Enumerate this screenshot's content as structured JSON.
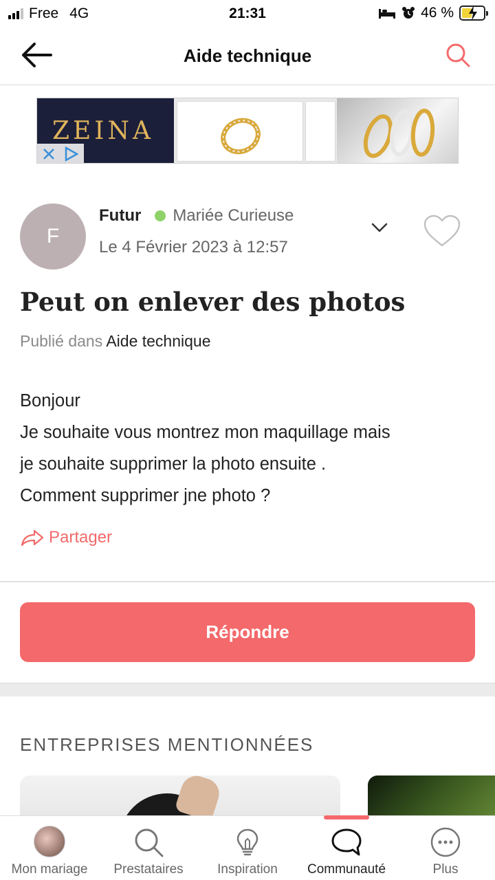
{
  "status_bar": {
    "carrier": "Free",
    "network": "4G",
    "time": "21:31",
    "battery": "46 %",
    "battery_level": 0.46
  },
  "header": {
    "title": "Aide technique",
    "back_icon": "arrow-left-icon",
    "search_icon": "search-icon"
  },
  "ad": {
    "brand": "ZEINA"
  },
  "post": {
    "avatar_initial": "F",
    "author": "Futur",
    "author_role": "Mariée Curieuse",
    "date": "Le 4 Février 2023 à 12:57",
    "title": "Peut on enlever des photos",
    "published_prefix": "Publié dans",
    "category": "Aide technique",
    "body": [
      "Bonjour",
      "Je souhaite vous montrez mon maquillage mais",
      "je souhaite supprimer la photo ensuite .",
      "Comment supprimer jne photo ?"
    ],
    "share_label": "Partager"
  },
  "reply_button": "Répondre",
  "mentioned": {
    "title": "ENTREPRISES MENTIONNÉES"
  },
  "bottom_nav": {
    "items": [
      {
        "label": "Mon mariage",
        "icon": "avatar-icon"
      },
      {
        "label": "Prestataires",
        "icon": "search-icon"
      },
      {
        "label": "Inspiration",
        "icon": "lightbulb-icon"
      },
      {
        "label": "Communauté",
        "icon": "chat-bubble-icon",
        "active": true
      },
      {
        "label": "Plus",
        "icon": "more-dots-icon"
      }
    ]
  },
  "colors": {
    "accent": "#f4696b",
    "online": "#8fd26a",
    "avatar_bg": "#bdb0b3"
  }
}
